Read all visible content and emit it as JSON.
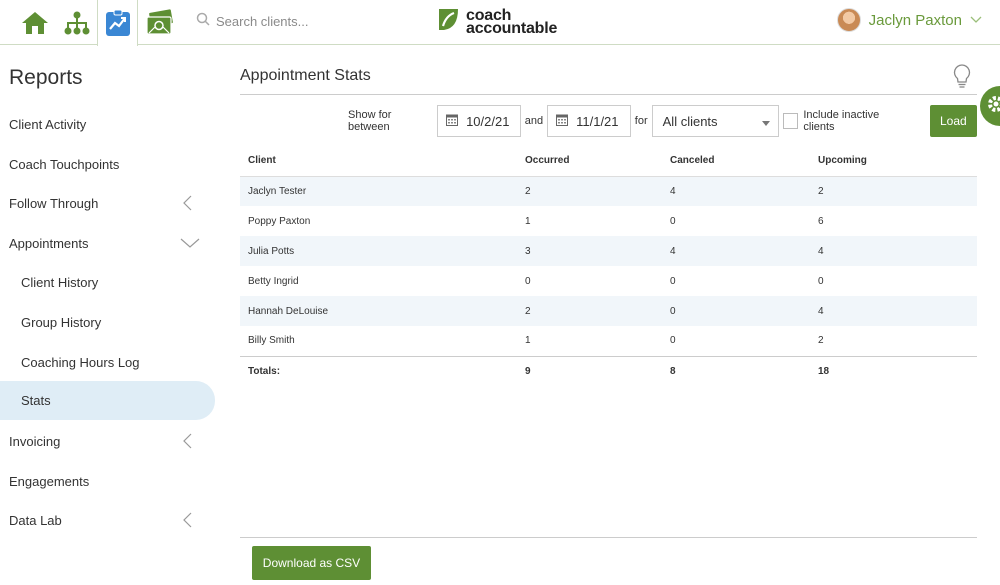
{
  "header": {
    "search_placeholder": "Search clients...",
    "logo_line1": "coach",
    "logo_line2": "accountable",
    "user_name": "Jaclyn Paxton",
    "nav_icons": [
      "home-icon",
      "org-chart-icon",
      "reports-clipboard-icon",
      "money-icon"
    ]
  },
  "sidebar": {
    "title": "Reports",
    "items": [
      {
        "label": "Client Activity"
      },
      {
        "label": "Coach Touchpoints"
      },
      {
        "label": "Follow Through"
      },
      {
        "label": "Appointments"
      },
      {
        "label": "Client History"
      },
      {
        "label": "Group History"
      },
      {
        "label": "Coaching Hours Log"
      },
      {
        "label": "Stats"
      },
      {
        "label": "Invoicing"
      },
      {
        "label": "Engagements"
      },
      {
        "label": "Data Lab"
      }
    ]
  },
  "main": {
    "title": "Appointment Stats",
    "filters": {
      "show_label": "Show for between",
      "start_date": "10/2/21",
      "and_label": "and",
      "end_date": "11/1/21",
      "for_label": "for",
      "client_select": "All clients",
      "inactive_label": "Include inactive clients",
      "load_label": "Load"
    },
    "table": {
      "headers": [
        "Client",
        "Occurred",
        "Canceled",
        "Upcoming"
      ],
      "rows": [
        [
          "Jaclyn Tester",
          "2",
          "4",
          "2"
        ],
        [
          "Poppy Paxton",
          "1",
          "0",
          "6"
        ],
        [
          "Julia Potts",
          "3",
          "4",
          "4"
        ],
        [
          "Betty Ingrid",
          "0",
          "0",
          "0"
        ],
        [
          "Hannah DeLouise",
          "2",
          "0",
          "4"
        ],
        [
          "Billy Smith",
          "1",
          "0",
          "2"
        ]
      ],
      "totals": [
        "Totals:",
        "9",
        "8",
        "18"
      ]
    },
    "download_label": "Download as CSV"
  },
  "colors": {
    "accent_green": "#5e8f34",
    "nav_blue": "#3a87d4",
    "active_bg": "#dfedf6"
  }
}
